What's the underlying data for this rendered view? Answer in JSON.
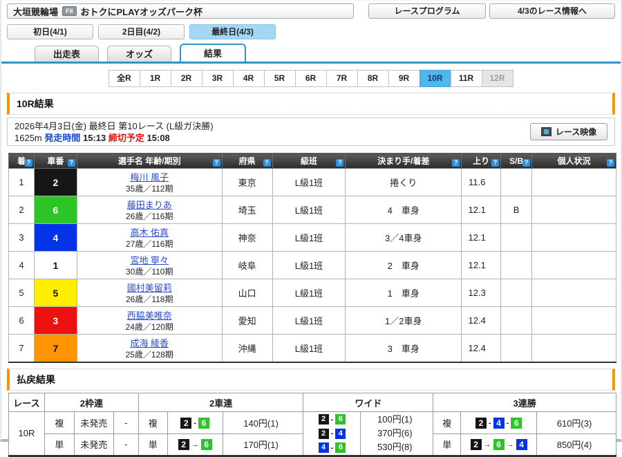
{
  "header": {
    "venue": "大垣競輪場",
    "grade_badge": "FII",
    "race_title": "おトクにPLAYオッズパーク杯",
    "program_button": "レースプログラム",
    "day_info_button": "4/3のレース情報へ"
  },
  "day_tabs": [
    {
      "label": "初日(4/1)"
    },
    {
      "label": "2日目(4/2)"
    },
    {
      "label": "最終日(4/3)"
    }
  ],
  "view_tabs": [
    {
      "label": "出走表"
    },
    {
      "label": "オッズ"
    },
    {
      "label": "結果"
    }
  ],
  "race_tabs": [
    {
      "label": "全R"
    },
    {
      "label": "1R"
    },
    {
      "label": "2R"
    },
    {
      "label": "3R"
    },
    {
      "label": "4R"
    },
    {
      "label": "5R"
    },
    {
      "label": "6R"
    },
    {
      "label": "7R"
    },
    {
      "label": "8R"
    },
    {
      "label": "9R"
    },
    {
      "label": "10R"
    },
    {
      "label": "11R"
    },
    {
      "label": "12R"
    }
  ],
  "result_section": {
    "title": "10R結果",
    "date_line": "2026年4月3日(金) 最終日 第10レース (L級ガ決勝)",
    "distance": "1625m",
    "start_label": "発走時間",
    "start_time": "15:13",
    "close_label": "締切予定",
    "close_time": "15:08",
    "video_button": "レース映像"
  },
  "results_table": {
    "help_icon": "?",
    "headers": [
      "着",
      "車番",
      "選手名 年齢/期別",
      "府県",
      "級班",
      "決まり手/着差",
      "上り",
      "S/B",
      "個人状況"
    ],
    "rows": [
      {
        "rank": "1",
        "bike": "2",
        "name": "梅川 風子",
        "age": "35歳／112期",
        "pref": "東京",
        "class": "L級1班",
        "margin": "捲くり",
        "lap": "11.6",
        "sb": "",
        "status": ""
      },
      {
        "rank": "2",
        "bike": "6",
        "name": "藤田まりあ",
        "age": "26歳／116期",
        "pref": "埼玉",
        "class": "L級1班",
        "margin": "4　車身",
        "lap": "12.1",
        "sb": "B",
        "status": ""
      },
      {
        "rank": "3",
        "bike": "4",
        "name": "高木 佑真",
        "age": "27歳／116期",
        "pref": "神奈",
        "class": "L級1班",
        "margin": "3／4車身",
        "lap": "12.1",
        "sb": "",
        "status": ""
      },
      {
        "rank": "4",
        "bike": "1",
        "name": "宮地 寧々",
        "age": "30歳／110期",
        "pref": "岐阜",
        "class": "L級1班",
        "margin": "2　車身",
        "lap": "12.1",
        "sb": "",
        "status": ""
      },
      {
        "rank": "5",
        "bike": "5",
        "name": "國村美留莉",
        "age": "26歳／118期",
        "pref": "山口",
        "class": "L級1班",
        "margin": "1　車身",
        "lap": "12.3",
        "sb": "",
        "status": ""
      },
      {
        "rank": "6",
        "bike": "3",
        "name": "西脇美唯奈",
        "age": "24歳／120期",
        "pref": "愛知",
        "class": "L級1班",
        "margin": "1／2車身",
        "lap": "12.4",
        "sb": "",
        "status": ""
      },
      {
        "rank": "7",
        "bike": "7",
        "name": "成海 綾香",
        "age": "25歳／128期",
        "pref": "沖縄",
        "class": "L級1班",
        "margin": "3　車身",
        "lap": "12.4",
        "sb": "",
        "status": ""
      }
    ]
  },
  "payout": {
    "title": "払戻結果",
    "headers": {
      "race": "レース",
      "waku2": "2枠連",
      "sha2": "2車連",
      "wide": "ワイド",
      "sanren": "3連勝"
    },
    "race_no": "10R",
    "waku2": {
      "fuku_label": "複",
      "fuku_value": "未発売",
      "fuku_pay": "-",
      "tan_label": "単",
      "tan_value": "未発売",
      "tan_pay": "-"
    },
    "sha2": {
      "fuku_label": "複",
      "fuku_a": "2",
      "fuku_sep": "-",
      "fuku_b": "6",
      "fuku_pay": "140円(1)",
      "tan_label": "単",
      "tan_a": "2",
      "tan_sep": "→",
      "tan_b": "6",
      "tan_pay": "170円(1)"
    },
    "wide": {
      "combos": [
        {
          "a": "2",
          "sep": "-",
          "b": "6"
        },
        {
          "a": "2",
          "sep": "-",
          "b": "4"
        },
        {
          "a": "4",
          "sep": "-",
          "b": "6"
        }
      ],
      "pays": [
        "100円(1)",
        "370円(6)",
        "530円(8)"
      ]
    },
    "sanren": {
      "fuku_label": "複",
      "fuku_a": "2",
      "fuku_s1": "-",
      "fuku_b": "4",
      "fuku_s2": "-",
      "fuku_c": "6",
      "fuku_pay": "610円(3)",
      "tan_label": "単",
      "tan_a": "2",
      "tan_s1": "→",
      "tan_b": "6",
      "tan_s2": "→",
      "tan_c": "4",
      "tan_pay": "850円(4)"
    }
  },
  "colors": {
    "accent_blue": "#2f96cc",
    "race_tab_active": "#4eb7ec",
    "day_tab_active": "#a4d7f4",
    "section_bar_orange": "#f59500",
    "payout_pink": "#fdecea",
    "header_dark": "#3a3a3a",
    "link_blue": "#2b4bcd",
    "start_label_blue": "#1d49c8",
    "close_label_red": "#e31212",
    "bike_1": "#ffffff",
    "bike_2": "#161616",
    "bike_3": "#ee1111",
    "bike_4": "#0433e8",
    "bike_5": "#ffee00",
    "bike_6": "#2dc428",
    "bike_7": "#ff9500"
  }
}
